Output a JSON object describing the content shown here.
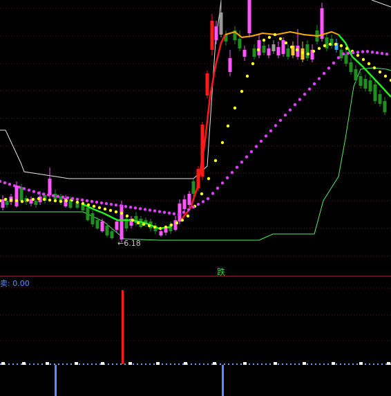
{
  "main_panel": {
    "low_price_label": "←6.18",
    "signal_label": "跌"
  },
  "sub_panel": {
    "sell_label": "卖: 0.00"
  },
  "colors": {
    "background": "#000000",
    "bull_candle": "#ff55ff",
    "bear_candle": "#1f8f1f",
    "trend_up": "#ff1a1a",
    "trend_down": "#22ee22",
    "signal_dots": "#ffff22",
    "slow_dots": "#e040ff",
    "envelope_upper": "#e8e8e8",
    "envelope_lower": "#55ee66",
    "grid_lines": "#6a1414",
    "panel_divider": "#cc2222",
    "sell_bars": "#5b8cff",
    "buy_bar": "#ff1a1a"
  }
}
